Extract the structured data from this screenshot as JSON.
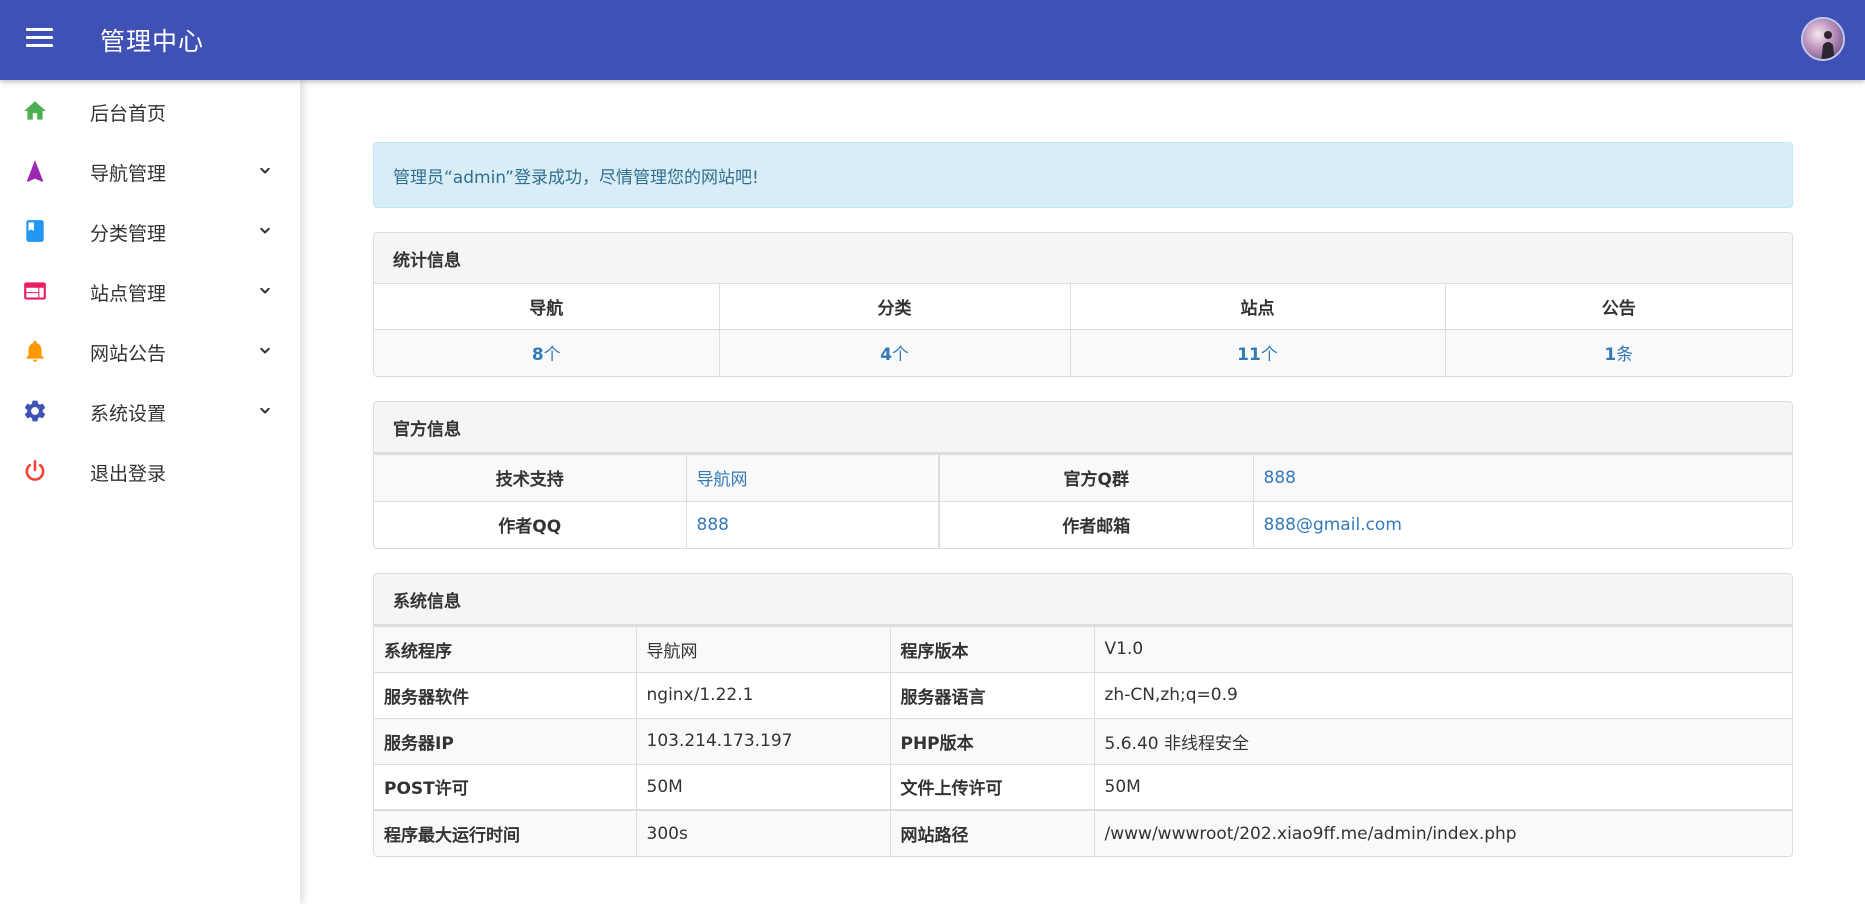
{
  "header": {
    "title": "管理中心",
    "colors": {
      "bar": "#3f51b5"
    }
  },
  "sidebar": {
    "items": [
      {
        "label": "后台首页",
        "icon": "home-icon",
        "color": "#4caf50",
        "expandable": false
      },
      {
        "label": "导航管理",
        "icon": "navigation-arrow-icon",
        "color": "#9c27b0",
        "expandable": true
      },
      {
        "label": "分类管理",
        "icon": "book-icon",
        "color": "#2196f3",
        "expandable": true
      },
      {
        "label": "站点管理",
        "icon": "web-window-icon",
        "color": "#e91e63",
        "expandable": true
      },
      {
        "label": "网站公告",
        "icon": "bell-icon",
        "color": "#ff9800",
        "expandable": true
      },
      {
        "label": "系统设置",
        "icon": "gear-icon",
        "color": "#3f51b5",
        "expandable": true
      },
      {
        "label": "退出登录",
        "icon": "power-icon",
        "color": "#f44336",
        "expandable": false
      }
    ]
  },
  "alert": {
    "text": "管理员“admin”登录成功，尽情管理您的网站吧!"
  },
  "stats": {
    "title": "统计信息",
    "headers": [
      "导航",
      "分类",
      "站点",
      "公告"
    ],
    "values": [
      {
        "num": "8",
        "unit": "个"
      },
      {
        "num": "4",
        "unit": "个"
      },
      {
        "num": "11",
        "unit": "个"
      },
      {
        "num": "1",
        "unit": "条"
      }
    ]
  },
  "official": {
    "title": "官方信息",
    "rows": [
      {
        "k1": "技术支持",
        "v1": "导航网",
        "k2": "官方Q群",
        "v2": "888"
      },
      {
        "k1": "作者QQ",
        "v1": "888",
        "k2": "作者邮箱",
        "v2": "888@gmail.com"
      }
    ]
  },
  "sysinfo": {
    "title": "系统信息",
    "rows": [
      {
        "k1": "系统程序",
        "v1": "导航网",
        "k2": "程序版本",
        "v2": "V1.0"
      },
      {
        "k1": "服务器软件",
        "v1": "nginx/1.22.1",
        "k2": "服务器语言",
        "v2": "zh-CN,zh;q=0.9"
      },
      {
        "k1": "服务器IP",
        "v1": "103.214.173.197",
        "k2": "PHP版本",
        "v2": "5.6.40 非线程安全"
      },
      {
        "k1": "POST许可",
        "v1": "50M",
        "k2": "文件上传许可",
        "v2": "50M"
      },
      {
        "k1": "程序最大运行时间",
        "v1": "300s",
        "k2": "网站路径",
        "v2": "/www/wwwroot/202.xiao9ff.me/admin/index.php"
      }
    ]
  }
}
